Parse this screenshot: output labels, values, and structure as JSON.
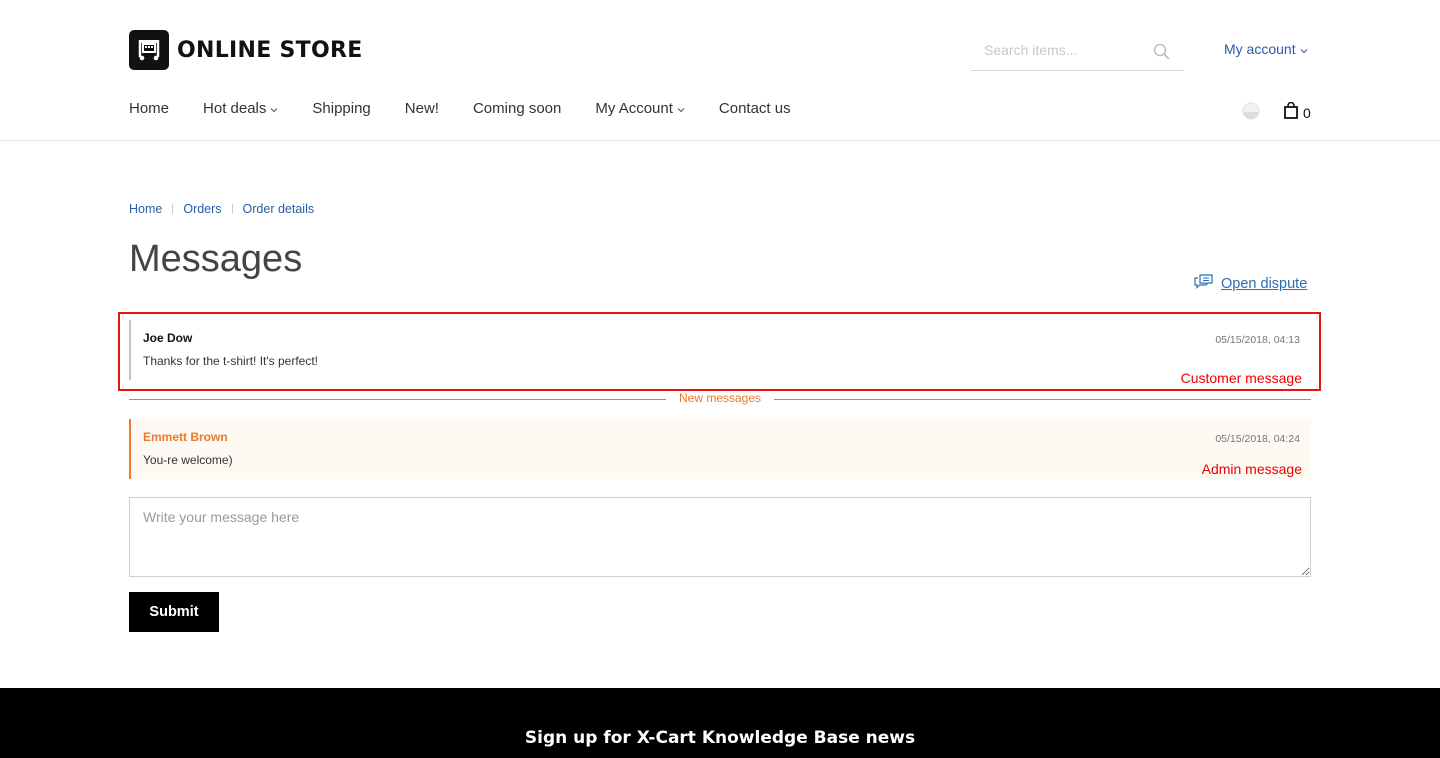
{
  "header": {
    "logo_text": "ONLINE STORE",
    "search_placeholder": "Search items...",
    "account_label": "My account",
    "cart_count": "0"
  },
  "nav": {
    "items": [
      {
        "label": "Home",
        "dropdown": false
      },
      {
        "label": "Hot deals",
        "dropdown": true
      },
      {
        "label": "Shipping",
        "dropdown": false
      },
      {
        "label": "New!",
        "dropdown": false
      },
      {
        "label": "Coming soon",
        "dropdown": false
      },
      {
        "label": "My Account",
        "dropdown": true
      },
      {
        "label": "Contact us",
        "dropdown": false
      }
    ]
  },
  "breadcrumb": [
    "Home",
    "Orders",
    "Order details"
  ],
  "page": {
    "title": "Messages",
    "open_dispute_label": "Open dispute"
  },
  "messages": [
    {
      "author": "Joe Dow",
      "text": "Thanks for the t-shirt! It's perfect!",
      "date": "05/15/2018, 04:13",
      "annotation": "Customer message"
    },
    {
      "author": "Emmett Brown",
      "text": "You-re welcome)",
      "date": "05/15/2018, 04:24",
      "annotation": "Admin message"
    }
  ],
  "new_messages_label": "New messages",
  "form": {
    "placeholder": "Write your message here",
    "submit_label": "Submit"
  },
  "footer": {
    "title": "Sign up for X-Cart Knowledge Base news"
  },
  "colors": {
    "link": "#2a5ca8",
    "accent": "#e8792f",
    "annotation": "#ee1111",
    "button": "#000000"
  }
}
